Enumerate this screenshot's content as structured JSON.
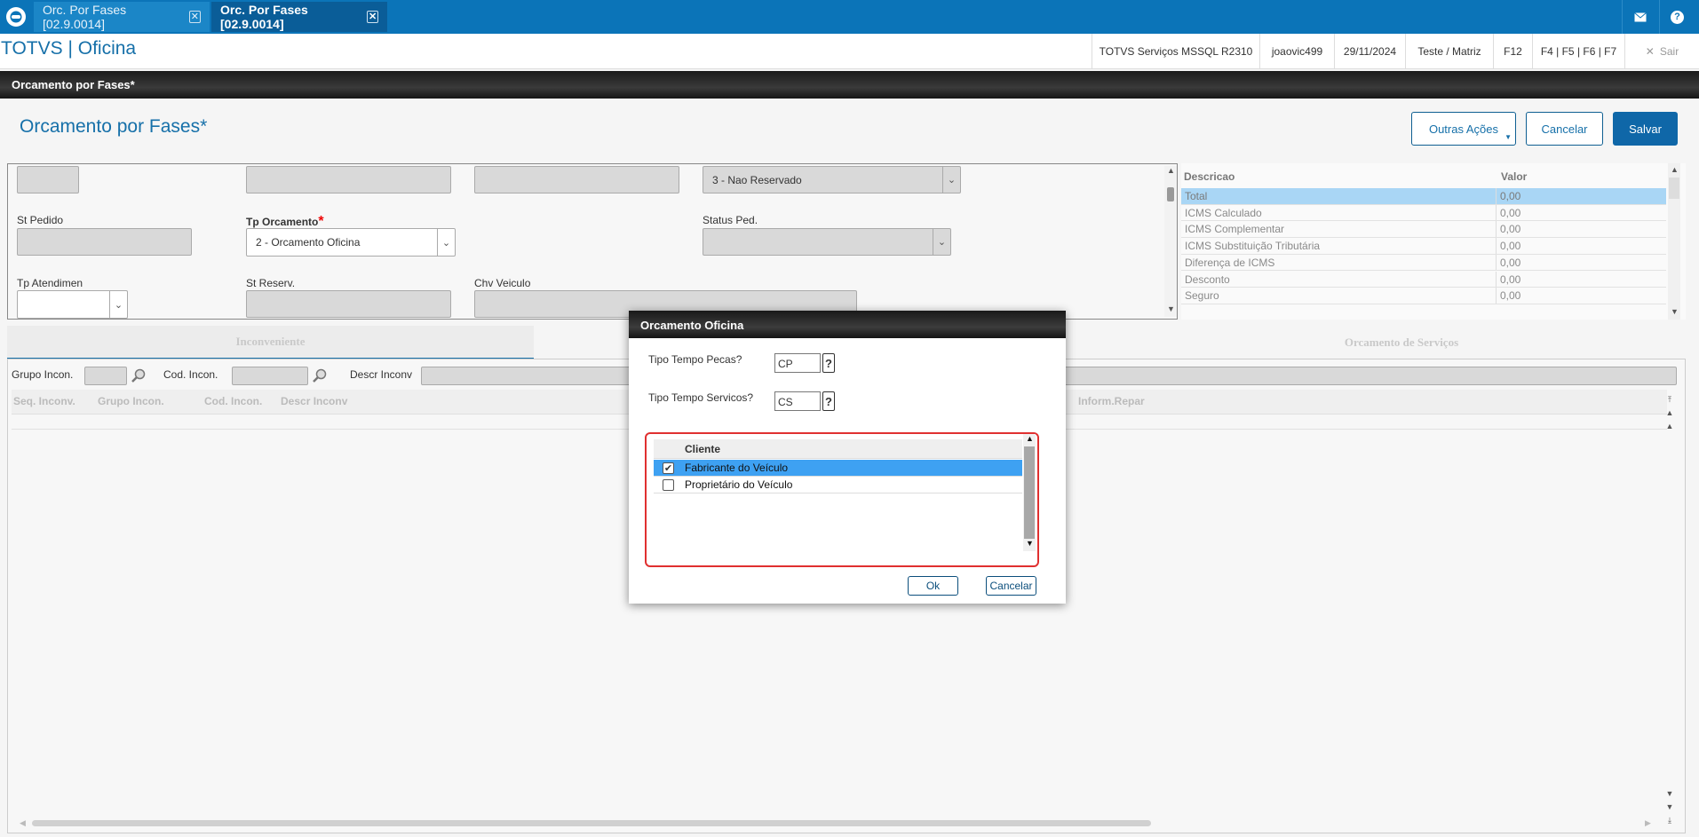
{
  "tabs": [
    {
      "label": "Orc. Por Fases [02.9.0014]"
    },
    {
      "label": "Orc. Por Fases [02.9.0014]"
    }
  ],
  "header": {
    "app_title": "TOTVS | Oficina",
    "server": "TOTVS Serviços MSSQL R2310",
    "user": "joaovic499",
    "date": "29/11/2024",
    "env": "Teste / Matriz",
    "key1": "F12",
    "keys": "F4 | F5 | F6 | F7",
    "exit": "Sair"
  },
  "window_title": "Orcamento por Fases*",
  "page_title": "Orcamento por Fases*",
  "actions": {
    "more": "Outras Ações",
    "cancel": "Cancelar",
    "save": "Salvar"
  },
  "form": {
    "reserva_value": "3 - Nao Reservado",
    "st_pedido_label": "St Pedido",
    "tp_orcamento_label": "Tp Orcamento",
    "tp_orcamento_value": "2 - Orcamento Oficina",
    "status_ped_label": "Status Ped.",
    "tp_atendimen_label": "Tp Atendimen",
    "st_reserv_label": "St Reserv.",
    "chv_veiculo_label": "Chv Veiculo"
  },
  "summary": {
    "col_desc": "Descricao",
    "col_val": "Valor",
    "rows": [
      {
        "desc": "Total",
        "val": "0,00"
      },
      {
        "desc": "ICMS Calculado",
        "val": "0,00"
      },
      {
        "desc": "ICMS Complementar",
        "val": "0,00"
      },
      {
        "desc": "ICMS Substituição Tributária",
        "val": "0,00"
      },
      {
        "desc": "Diferença de ICMS",
        "val": "0,00"
      },
      {
        "desc": "Desconto",
        "val": "0,00"
      },
      {
        "desc": "Seguro",
        "val": "0,00"
      }
    ]
  },
  "subtabs": {
    "inconveniente": "Inconveniente",
    "servicos": "Orcamento de Serviços"
  },
  "filters": {
    "grupo": "Grupo Incon.",
    "cod": "Cod. Incon.",
    "descr": "Descr Inconv"
  },
  "grid_headers": {
    "seq": "Seq. Inconv.",
    "grupo": "Grupo Incon.",
    "cod": "Cod. Incon.",
    "descr": "Descr Inconv",
    "inform": "Inform.Repar"
  },
  "dialog": {
    "title": "Orcamento Oficina",
    "pecas_label": "Tipo Tempo Pecas?",
    "pecas_value": "CP",
    "servicos_label": "Tipo Tempo Servicos?",
    "servicos_value": "CS",
    "help": "?",
    "list_header": "Cliente",
    "items": [
      {
        "label": "Fabricante do Veículo",
        "checked": true
      },
      {
        "label": "Proprietário do Veículo",
        "checked": false
      }
    ],
    "ok": "Ok",
    "cancel": "Cancelar"
  }
}
